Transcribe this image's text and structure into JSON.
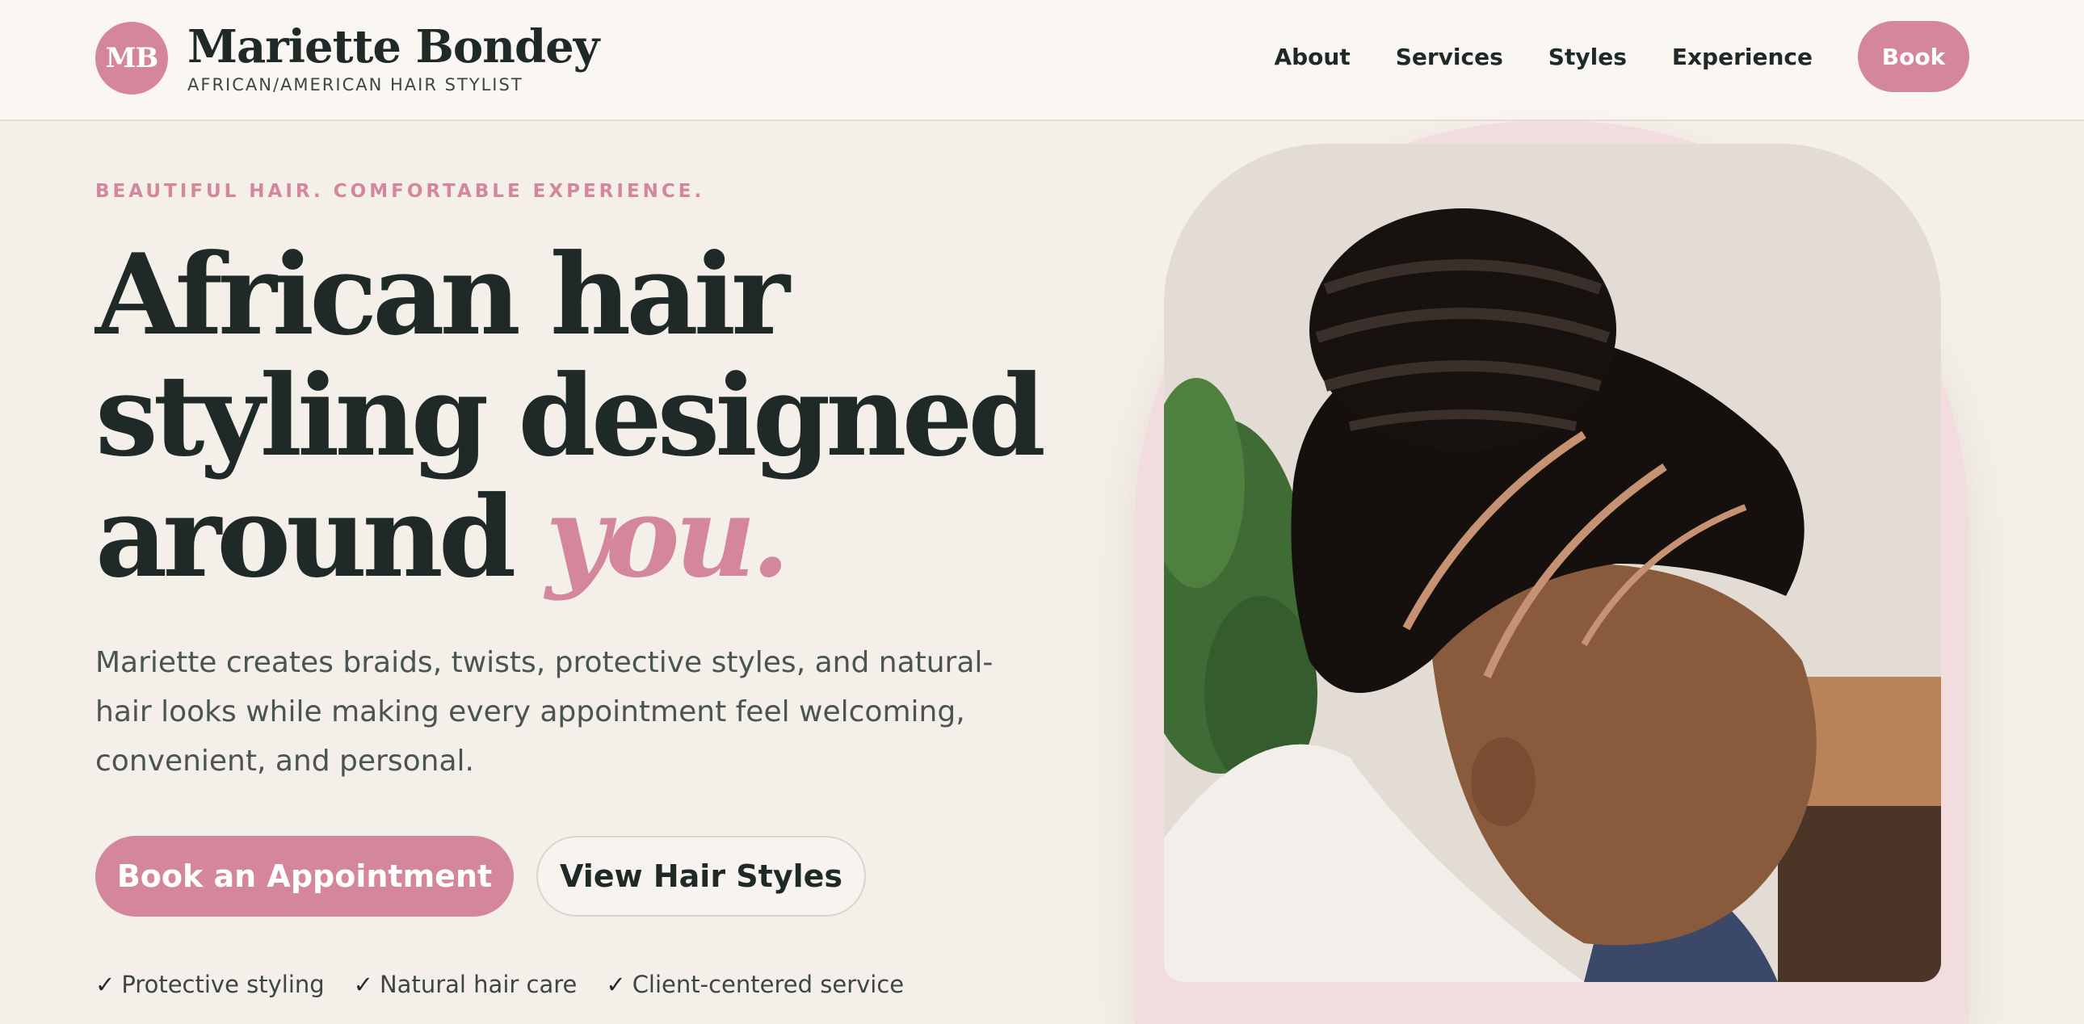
{
  "header": {
    "logo_initials": "MB",
    "brand_name": "Mariette Bondey",
    "brand_tagline": "AFRICAN/AMERICAN HAIR STYLIST",
    "nav": [
      "About",
      "Services",
      "Styles",
      "Experience"
    ],
    "book_label": "Book"
  },
  "hero": {
    "eyebrow": "BEAUTIFUL HAIR. COMFORTABLE EXPERIENCE.",
    "headline_line1": "African hair",
    "headline_line2": "styling designed",
    "headline_line3_a": "around",
    "headline_accent": "you.",
    "lede": "Mariette creates braids, twists, protective styles, and natural-hair looks while making every appointment feel welcoming, convenient, and personal.",
    "primary_cta": "Book an Appointment",
    "secondary_cta": "View Hair Styles",
    "features": [
      "Protective styling",
      "Natural hair care",
      "Client-centered service"
    ],
    "check_glyph": "✓"
  },
  "colors": {
    "accent": "#d4879a",
    "ink": "#1f2a28",
    "background": "#f4efe9",
    "header_bg": "#faf6f1",
    "arch": "#f3dcde"
  }
}
